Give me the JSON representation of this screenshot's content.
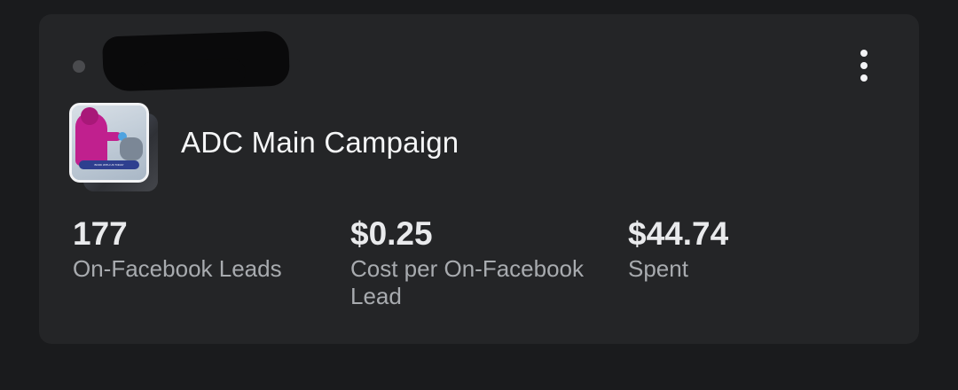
{
  "card": {
    "campaign_name": "ADC Main Campaign",
    "thumbnail": {
      "banner_text": "BOOK WITH US TODAY"
    },
    "metrics": [
      {
        "value": "177",
        "label": "On-Facebook Leads"
      },
      {
        "value": "$0.25",
        "label": "Cost per On-Facebook Lead"
      },
      {
        "value": "$44.74",
        "label": "Spent"
      }
    ]
  },
  "colors": {
    "background": "#1a1b1d",
    "card": "#242527",
    "text_primary": "#e9eaec",
    "text_secondary": "#a8abaf",
    "status_dot": "#4a4b4e"
  },
  "icons": {
    "status": "status-dot-icon",
    "menu": "more-vertical-icon"
  }
}
